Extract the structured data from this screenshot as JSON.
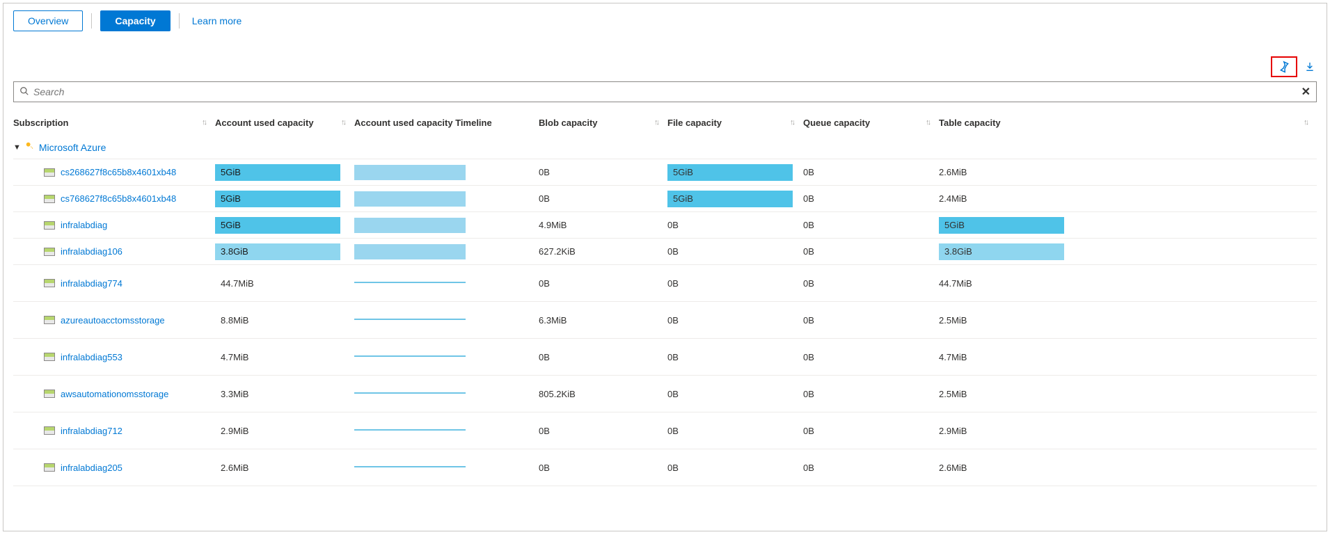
{
  "tabs": {
    "overview": "Overview",
    "capacity": "Capacity",
    "learn": "Learn more"
  },
  "search": {
    "placeholder": "Search"
  },
  "columns": {
    "subscription": "Subscription",
    "account_used": "Account used capacity",
    "timeline": "Account used capacity Timeline",
    "blob": "Blob capacity",
    "file": "File capacity",
    "queue": "Queue capacity",
    "table": "Table capacity"
  },
  "group": {
    "label": "Microsoft Azure"
  },
  "rows": [
    {
      "name": "cs268627f8c65b8x4601xb48",
      "used": "5GiB",
      "used_pct": 100,
      "tl": "block",
      "blob": "0B",
      "file": "5GiB",
      "file_bar": "full",
      "queue": "0B",
      "table": "2.6MiB",
      "table_bar": ""
    },
    {
      "name": "cs768627f8c65b8x4601xb48",
      "used": "5GiB",
      "used_pct": 100,
      "tl": "block",
      "blob": "0B",
      "file": "5GiB",
      "file_bar": "full",
      "queue": "0B",
      "table": "2.4MiB",
      "table_bar": ""
    },
    {
      "name": "infralabdiag",
      "used": "5GiB",
      "used_pct": 100,
      "tl": "block",
      "blob": "4.9MiB",
      "file": "0B",
      "file_bar": "",
      "queue": "0B",
      "table": "5GiB",
      "table_bar": "full"
    },
    {
      "name": "infralabdiag106",
      "used": "3.8GiB",
      "used_pct": 100,
      "used_lite": true,
      "tl": "block",
      "blob": "627.2KiB",
      "file": "0B",
      "file_bar": "",
      "queue": "0B",
      "table": "3.8GiB",
      "table_bar": "lite"
    },
    {
      "name": "infralabdiag774",
      "used": "44.7MiB",
      "used_pct": 0,
      "tl": "line",
      "blob": "0B",
      "file": "0B",
      "file_bar": "",
      "queue": "0B",
      "table": "44.7MiB",
      "table_bar": ""
    },
    {
      "name": "azureautoacctomsstorage",
      "used": "8.8MiB",
      "used_pct": 0,
      "tl": "line",
      "blob": "6.3MiB",
      "file": "0B",
      "file_bar": "",
      "queue": "0B",
      "table": "2.5MiB",
      "table_bar": ""
    },
    {
      "name": "infralabdiag553",
      "used": "4.7MiB",
      "used_pct": 0,
      "tl": "line",
      "blob": "0B",
      "file": "0B",
      "file_bar": "",
      "queue": "0B",
      "table": "4.7MiB",
      "table_bar": ""
    },
    {
      "name": "awsautomationomsstorage",
      "used": "3.3MiB",
      "used_pct": 0,
      "tl": "line",
      "blob": "805.2KiB",
      "file": "0B",
      "file_bar": "",
      "queue": "0B",
      "table": "2.5MiB",
      "table_bar": ""
    },
    {
      "name": "infralabdiag712",
      "used": "2.9MiB",
      "used_pct": 0,
      "tl": "line",
      "blob": "0B",
      "file": "0B",
      "file_bar": "",
      "queue": "0B",
      "table": "2.9MiB",
      "table_bar": ""
    },
    {
      "name": "infralabdiag205",
      "used": "2.6MiB",
      "used_pct": 0,
      "tl": "line",
      "blob": "0B",
      "file": "0B",
      "file_bar": "",
      "queue": "0B",
      "table": "2.6MiB",
      "table_bar": ""
    }
  ]
}
